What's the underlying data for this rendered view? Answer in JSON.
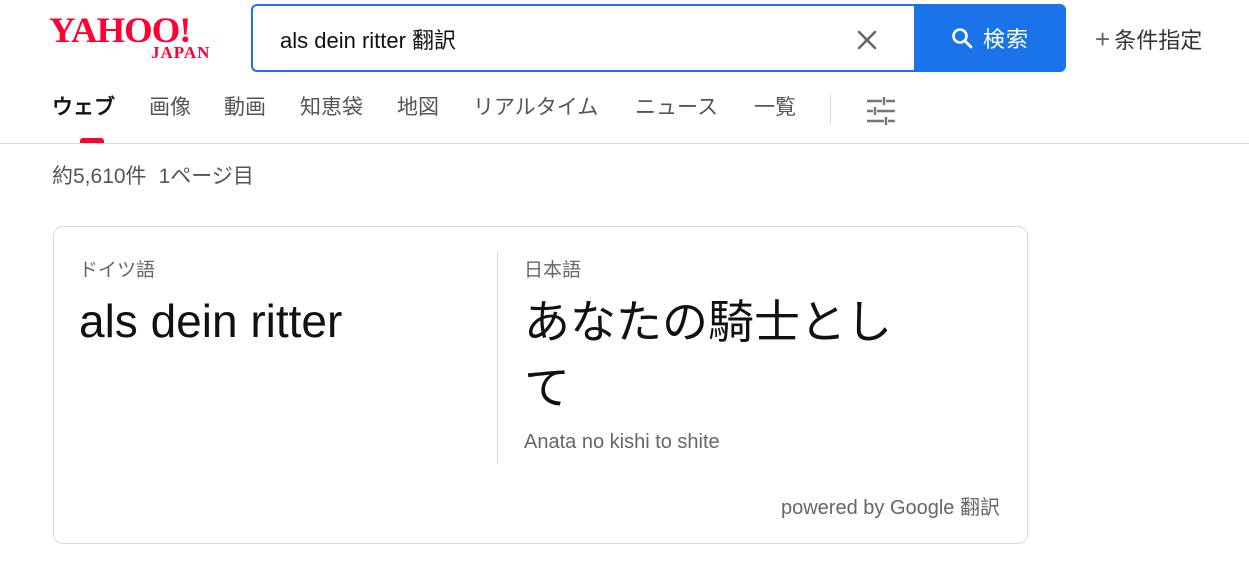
{
  "brand": {
    "logo_main": "YAHOO!",
    "logo_sub": "JAPAN",
    "color": "#ff0033"
  },
  "search": {
    "query": "als dein ritter 翻訳",
    "clear_icon": "close-icon",
    "button_icon": "search-icon",
    "button_label": "検索",
    "accent": "#1a73e8"
  },
  "advanced_search": {
    "icon": "plus-icon",
    "label": "条件指定"
  },
  "tabs": [
    {
      "label": "ウェブ",
      "active": true
    },
    {
      "label": "画像",
      "active": false
    },
    {
      "label": "動画",
      "active": false
    },
    {
      "label": "知恵袋",
      "active": false
    },
    {
      "label": "地図",
      "active": false
    },
    {
      "label": "リアルタイム",
      "active": false
    },
    {
      "label": "ニュース",
      "active": false
    },
    {
      "label": "一覧",
      "active": false
    }
  ],
  "tab_filter_icon": "sliders-icon",
  "result_meta": {
    "count": "約5,610件",
    "page": "1ページ目"
  },
  "translation": {
    "source_lang": "ドイツ語",
    "source_text": "als dein ritter",
    "target_lang": "日本語",
    "target_text": "あなたの騎士として",
    "romanization": "Anata no kishi to shite",
    "powered_by": "powered by Google 翻訳"
  }
}
